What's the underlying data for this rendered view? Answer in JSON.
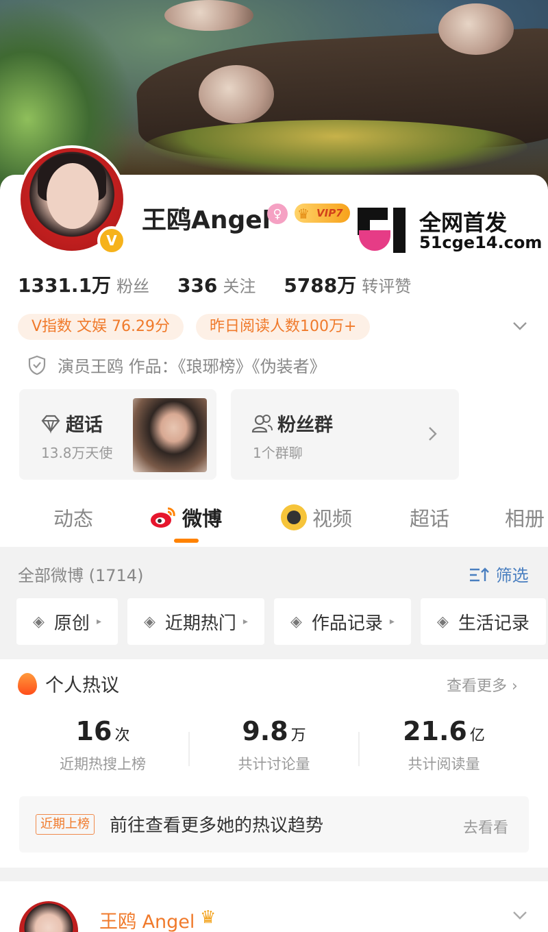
{
  "profile": {
    "name": "王鸥Angel",
    "vip_label": "VIP7",
    "verify_badge": "V",
    "stats": [
      {
        "value": "1331.1万",
        "label": "粉丝"
      },
      {
        "value": "336",
        "label": "关注"
      },
      {
        "value": "5788万",
        "label": "转评赞"
      }
    ],
    "pills": [
      "V指数 文娱 76.29分",
      "昨日阅读人数100万+"
    ],
    "description": "演员王鸥 作品：《琅琊榜》《伪装者》"
  },
  "watermark": {
    "title": "全网首发",
    "url": "51cge14.com",
    "logo_text": "51"
  },
  "tiles": {
    "supertopic": {
      "title": "超话",
      "sub": "13.8万天使"
    },
    "fangroup": {
      "title": "粉丝群",
      "sub": "1个群聊"
    }
  },
  "tabs": [
    "动态",
    "微博",
    "视频",
    "超话",
    "相册"
  ],
  "feed": {
    "all_label": "全部微博 (1714)",
    "filter_label": "筛选",
    "chips": [
      "原创",
      "近期热门",
      "作品记录",
      "生活记录"
    ]
  },
  "hot": {
    "title": "个人热议",
    "see_more": "查看更多",
    "metrics": [
      {
        "value": "16",
        "unit": "次",
        "label": "近期热搜上榜"
      },
      {
        "value": "9.8",
        "unit": "万",
        "label": "共计讨论量"
      },
      {
        "value": "21.6",
        "unit": "亿",
        "label": "共计阅读量"
      }
    ],
    "trend_tag": "近期上榜",
    "trend_text": "前往查看更多她的热议趋势",
    "trend_go": "去看看"
  },
  "post": {
    "author": "王鸥 Angel"
  },
  "colors": {
    "accent": "#ff8200",
    "orange_text": "#f07a2b",
    "link_blue": "#4a7fc0"
  },
  "icons": [
    "female-icon",
    "vip-crown-icon",
    "chevron-down-icon",
    "shield-icon",
    "diamond-icon",
    "group-icon",
    "chevron-right-icon",
    "weibo-icon",
    "video-icon",
    "filter-icon",
    "layers-icon",
    "flame-icon"
  ]
}
